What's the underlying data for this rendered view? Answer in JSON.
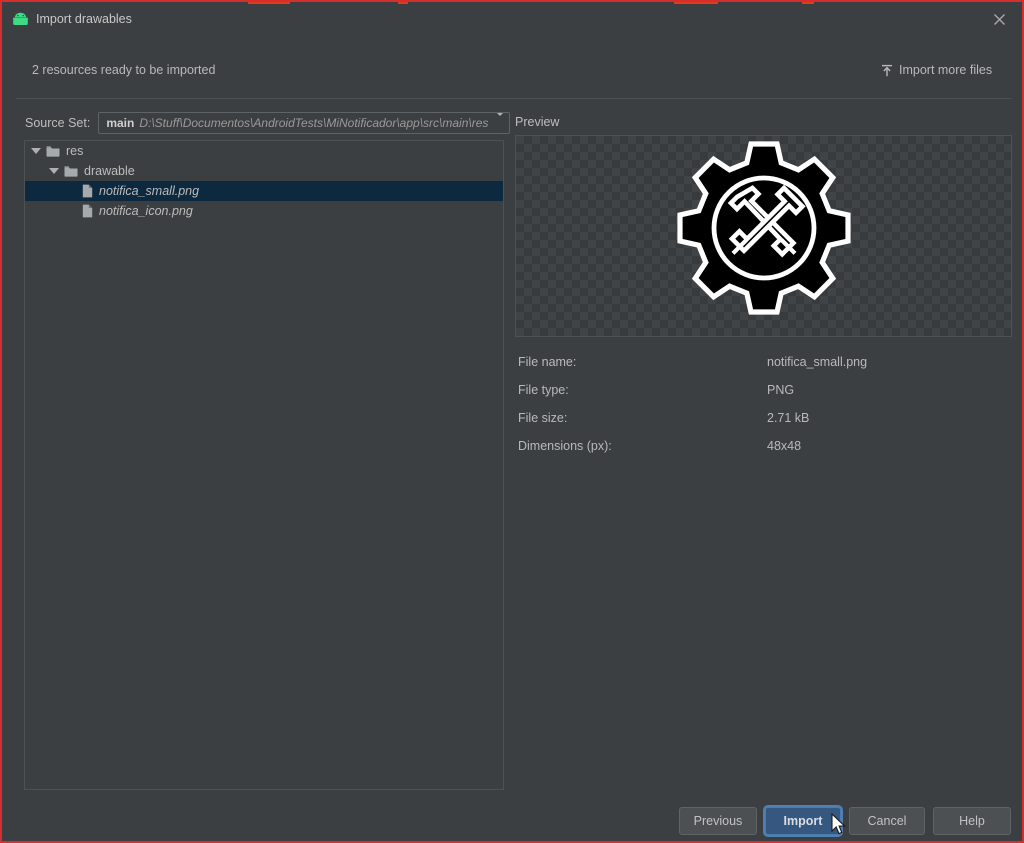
{
  "window": {
    "title": "Import drawables",
    "app_icon": "android-robot-icon",
    "close_icon": "close-icon",
    "accent_color": "#365880",
    "background_color": "#3c3f41",
    "selection_color": "#0d293f",
    "capture_border_color": "#d42e2e"
  },
  "header": {
    "resource_count_text": "2 resources ready to be imported",
    "import_more_files_label": "Import more files",
    "import_more_files_icon": "upload-icon"
  },
  "source_set": {
    "label": "Source Set:",
    "value": "main",
    "path": "D:\\Stuff\\Documentos\\AndroidTests\\MiNotificador\\app\\src\\main\\res",
    "dropdown_icon": "chevron-down-icon"
  },
  "tree": {
    "items": [
      {
        "label": "res",
        "depth": 0,
        "type": "folder",
        "icon": "folder-icon",
        "expanded": true,
        "selected": false,
        "italic": false
      },
      {
        "label": "drawable",
        "depth": 1,
        "type": "folder",
        "icon": "folder-icon",
        "expanded": true,
        "selected": false,
        "italic": false
      },
      {
        "label": "notifica_small.png",
        "depth": 2,
        "type": "file",
        "icon": "file-icon",
        "expanded": null,
        "selected": true,
        "italic": true
      },
      {
        "label": "notifica_icon.png",
        "depth": 2,
        "type": "file",
        "icon": "file-icon",
        "expanded": null,
        "selected": false,
        "italic": true
      }
    ]
  },
  "preview": {
    "label": "Preview",
    "image_icon": "gear-with-tools-icon"
  },
  "details": {
    "rows": [
      {
        "key": "File name:",
        "value": "notifica_small.png"
      },
      {
        "key": "File type:",
        "value": "PNG"
      },
      {
        "key": "File size:",
        "value": "2.71 kB"
      },
      {
        "key": "Dimensions (px):",
        "value": "48x48"
      }
    ]
  },
  "buttons": {
    "previous": "Previous",
    "import": "Import",
    "cancel": "Cancel",
    "help": "Help"
  }
}
